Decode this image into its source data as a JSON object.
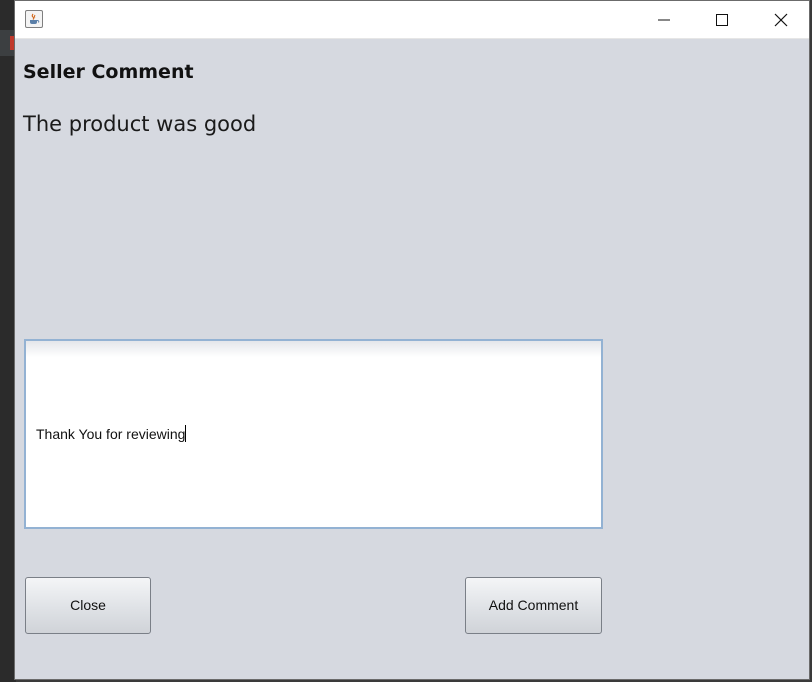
{
  "window": {
    "icon": "java-cup-icon",
    "controls": [
      "minimize-icon",
      "maximize-icon",
      "close-icon"
    ]
  },
  "main": {
    "heading": "Seller Comment",
    "comment": "The product was good"
  },
  "reply": {
    "value": "Thank You for reviewing"
  },
  "buttons": {
    "close_label": "Close",
    "add_comment_label": "Add Comment"
  }
}
